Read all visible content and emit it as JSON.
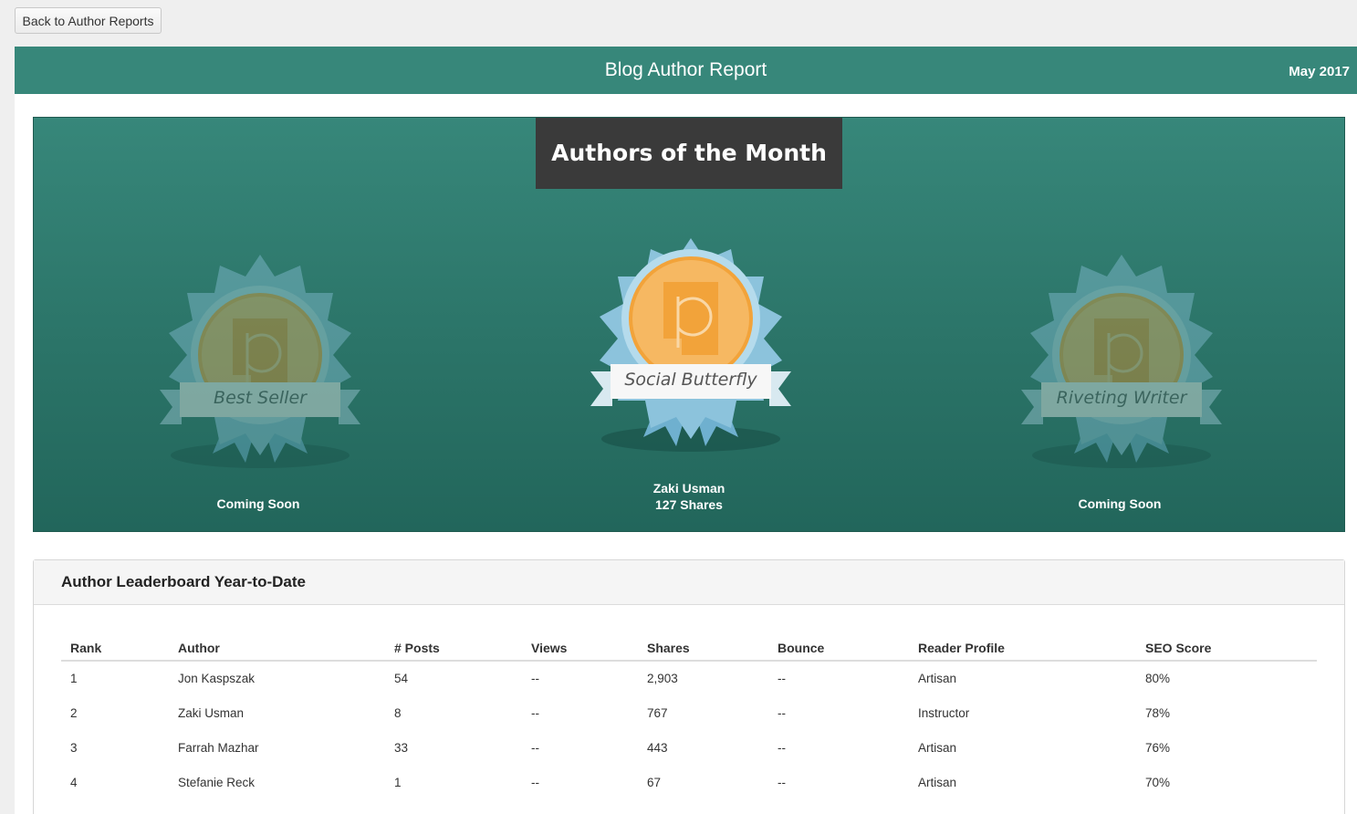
{
  "toolbar": {
    "back_label": "Back to Author Reports"
  },
  "header": {
    "title": "Blog Author Report",
    "date": "May 2017"
  },
  "authors_of_month": {
    "title": "Authors of the Month",
    "badges": [
      {
        "ribbon": "Best Seller",
        "caption_line1": "Coming Soon",
        "caption_line2": "",
        "active": false
      },
      {
        "ribbon": "Social Butterfly",
        "caption_line1": "Zaki Usman",
        "caption_line2": "127 Shares",
        "active": true
      },
      {
        "ribbon": "Riveting Writer",
        "caption_line1": "Coming Soon",
        "caption_line2": "",
        "active": false
      }
    ]
  },
  "leaderboard": {
    "title": "Author Leaderboard Year-to-Date",
    "columns": [
      "Rank",
      "Author",
      "# Posts",
      "Views",
      "Shares",
      "Bounce",
      "Reader Profile",
      "SEO Score"
    ],
    "rows": [
      [
        "1",
        "Jon Kaspszak",
        "54",
        "--",
        "2,903",
        "--",
        "Artisan",
        "80%"
      ],
      [
        "2",
        "Zaki Usman",
        "8",
        "--",
        "767",
        "--",
        "Instructor",
        "78%"
      ],
      [
        "3",
        "Farrah Mazhar",
        "33",
        "--",
        "443",
        "--",
        "Artisan",
        "76%"
      ],
      [
        "4",
        "Stefanie Reck",
        "1",
        "--",
        "67",
        "--",
        "Artisan",
        "70%"
      ]
    ]
  },
  "colors": {
    "header_bg": "#37877a",
    "title_box_bg": "#3a3a3a",
    "medal_orange": "#f2a33a",
    "rosette_blue": "#8cc3dc"
  }
}
